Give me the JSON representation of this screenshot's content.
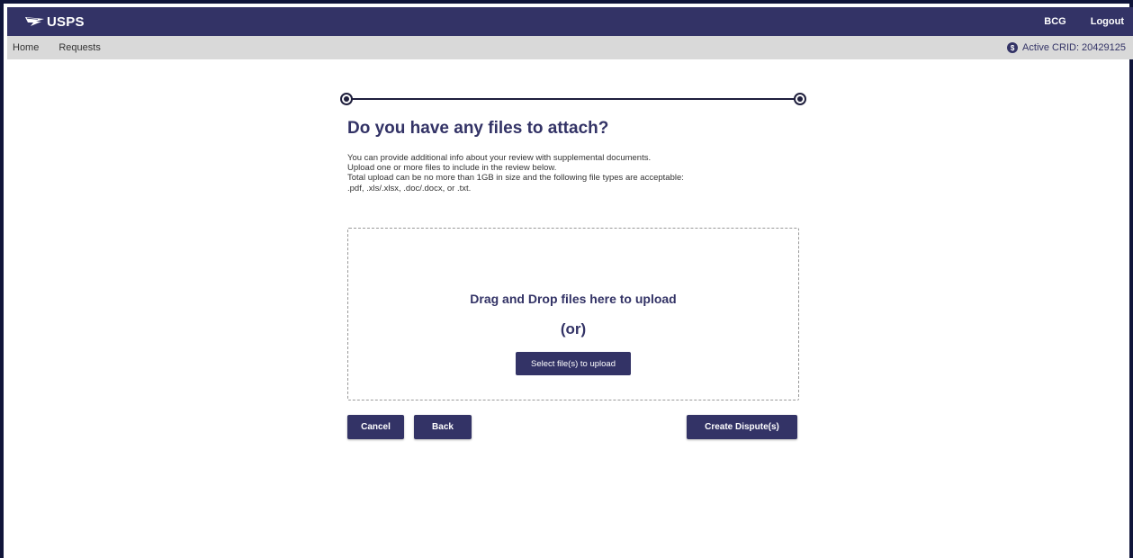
{
  "header": {
    "logo_text": "USPS",
    "links": [
      "BCG",
      "Logout"
    ]
  },
  "subnav": {
    "links": [
      "Home",
      "Requests"
    ],
    "crid_icon": "dollar-circle-icon",
    "crid_label": "Active CRID: 20429125"
  },
  "stepper": {
    "steps": 2,
    "current_step": 2
  },
  "content": {
    "heading": "Do you have any files to attach?",
    "description": [
      "You can provide additional info about your review with supplemental documents.",
      "Upload one or more files to include in the review below.",
      "Total upload can be no more than 1GB in size and the following file types are acceptable:",
      ".pdf, .xls/.xlsx, .doc/.docx, or .txt."
    ]
  },
  "dropzone": {
    "title": "Drag and Drop files here to upload",
    "or_text": "(or)",
    "select_button": "Select file(s) to upload"
  },
  "actions": {
    "cancel": "Cancel",
    "back": "Back",
    "create": "Create Dispute(s)"
  },
  "colors": {
    "primary": "#333366",
    "subnav_bg": "#d9d9d9",
    "frame": "#10153a"
  }
}
